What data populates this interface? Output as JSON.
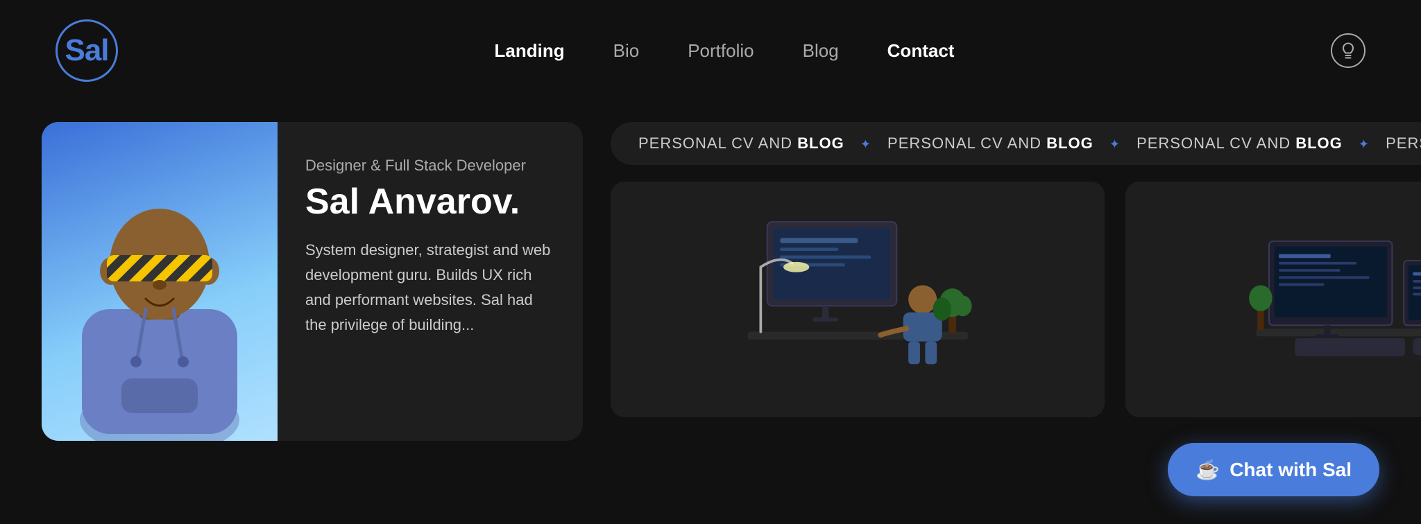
{
  "logo": {
    "text": "Sal"
  },
  "nav": {
    "items": [
      {
        "label": "Landing",
        "active": true
      },
      {
        "label": "Bio",
        "active": false
      },
      {
        "label": "Portfolio",
        "active": false
      },
      {
        "label": "Blog",
        "active": false
      },
      {
        "label": "Contact",
        "active": true
      }
    ]
  },
  "theme_icon": "lightbulb-icon",
  "hero": {
    "subtitle": "Designer & Full Stack Developer",
    "name": "Sal Anvarov.",
    "description": "System designer, strategist and web development guru. Builds UX rich and performant websites. Sal had the privilege of building..."
  },
  "ticker": {
    "segments": [
      "PERSONAL CV AND BLOG",
      "PERSONAL CV AND BLOG",
      "PERSONAL CV AND BLOG"
    ]
  },
  "chat_button": {
    "emoji": "☕",
    "label": "Chat with Sal"
  }
}
